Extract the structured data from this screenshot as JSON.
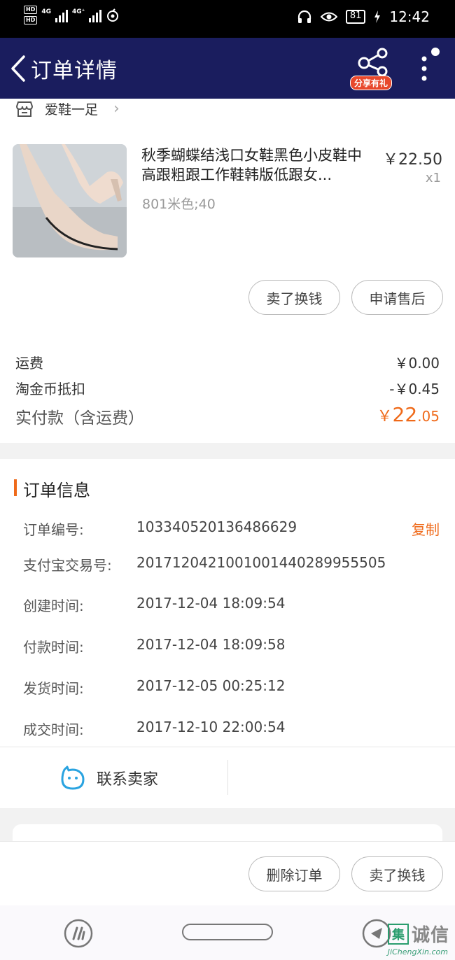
{
  "status_bar": {
    "hd1": "HD",
    "hd2": "HD",
    "net1": "4G",
    "net2": "4G⁺",
    "battery": "81",
    "time": "12:42"
  },
  "header": {
    "title": "订单详情",
    "share_badge": "分享有礼"
  },
  "shop": {
    "name": "爱鞋一足"
  },
  "product": {
    "title": "秋季蝴蝶结浅口女鞋黑色小皮鞋中高跟粗跟工作鞋韩版低跟女...",
    "price": "￥22.50",
    "quantity": "x1",
    "sku": "801米色;40"
  },
  "item_actions": {
    "sell_label": "卖了换钱",
    "after_sale_label": "申请售后"
  },
  "fees": {
    "shipping_label": "运费",
    "shipping_value": "￥0.00",
    "coin_label": "淘金币抵扣",
    "coin_value": "-￥0.45",
    "paid_label": "实付款（含运费）",
    "paid_currency": "￥",
    "paid_integer": "22",
    "paid_decimal": ".05"
  },
  "order_info": {
    "section_title": "订单信息",
    "copy_label": "复制",
    "rows": [
      {
        "label": "订单编号:",
        "value": "103340520136486629"
      },
      {
        "label": "支付宝交易号:",
        "value": "2017120421001001440289955505"
      },
      {
        "label": "创建时间:",
        "value": "2017-12-04 18:09:54"
      },
      {
        "label": "付款时间:",
        "value": "2017-12-04 18:09:58"
      },
      {
        "label": "发货时间:",
        "value": "2017-12-05 00:25:12"
      },
      {
        "label": "成交时间:",
        "value": "2017-12-10 22:00:54"
      }
    ]
  },
  "contact": {
    "label": "联系卖家"
  },
  "bottom_actions": {
    "delete_label": "删除订单",
    "sell_label": "卖了换钱"
  },
  "watermark": {
    "mark": "集",
    "text": "诚信",
    "url": "JiChengXin.com"
  },
  "colors": {
    "nav_bg": "#1a1d5e",
    "accent": "#ef6a1a",
    "contact_icon": "#29a3e0"
  }
}
